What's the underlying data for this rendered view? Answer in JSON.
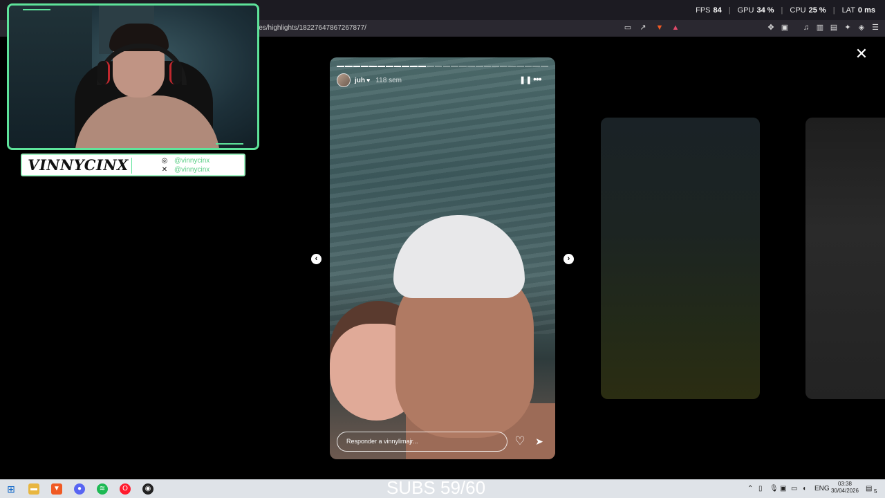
{
  "overlay": {
    "stats": [
      {
        "label": "FPS",
        "value": "84"
      },
      {
        "label": "GPU",
        "value": "34 %"
      },
      {
        "label": "CPU",
        "value": "25 %"
      },
      {
        "label": "LAT",
        "value": "0 ms"
      }
    ]
  },
  "browser": {
    "url_fragment": "ies/highlights/18227647867267877/"
  },
  "streamer": {
    "logo": "VINNYCINX",
    "instagram": "@vinnycinx",
    "x": "@vinnycinx"
  },
  "story": {
    "username": "juh",
    "time_ago": "118 sem",
    "reply_placeholder": "Responder a vinnylimajr...",
    "segments_total": 26,
    "segments_viewed": 11
  },
  "subs_counter": "SUBS 59/60",
  "taskbar": {
    "language": "ENG",
    "time": "03:38",
    "date": "30/04/2026",
    "notifications": "5"
  },
  "icons": {
    "close": "close-icon",
    "pause": "pause-icon",
    "more": "more-options-icon",
    "like": "heart-icon",
    "send": "send-icon",
    "prev": "chevron-left-icon",
    "next": "chevron-right-icon"
  },
  "colors": {
    "accent": "#5ee39a",
    "background": "#000000"
  }
}
